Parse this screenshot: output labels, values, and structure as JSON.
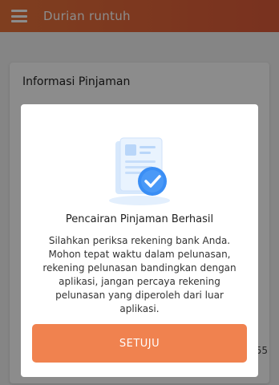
{
  "appbar": {
    "title": "Durian runtuh"
  },
  "card": {
    "title": "Informasi Pinjaman",
    "partial_value": "55"
  },
  "dialog": {
    "title": "Pencairan Pinjaman Berhasil",
    "message": "Silahkan periksa rekening bank Anda. Mohon tepat waktu dalam pelunasan, rekening pelunasan bandingkan dengan aplikasi, jangan percaya rekening pelunasan yang diperoleh dari luar aplikasi.",
    "confirm_label": "SETUJU",
    "illustration_icon": "document-check-icon"
  },
  "colors": {
    "accent": "#f0824f",
    "appbar": "#e2643a",
    "check": "#3a8ef5"
  }
}
